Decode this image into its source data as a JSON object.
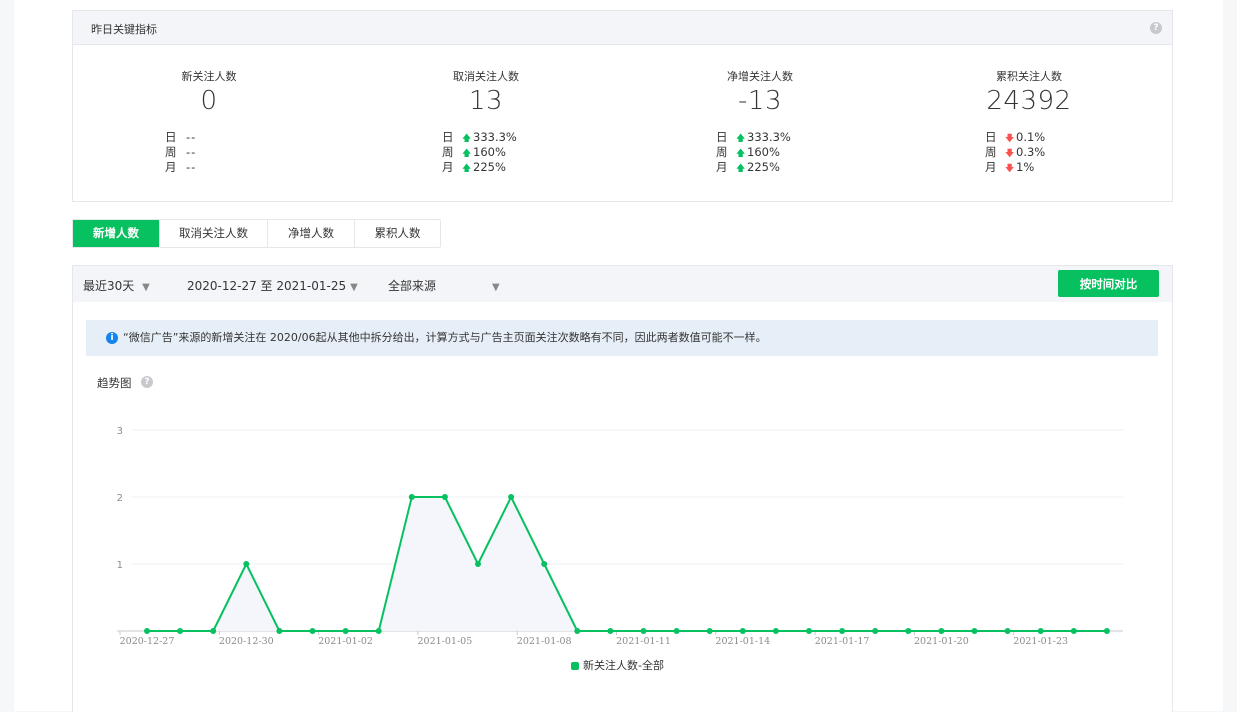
{
  "summary": {
    "title": "昨日关键指标",
    "help_icon": "?",
    "metrics": [
      {
        "label": "新关注人数",
        "value": "0",
        "rows": [
          {
            "period": "日",
            "dir": "none",
            "text": "--"
          },
          {
            "period": "周",
            "dir": "none",
            "text": "--"
          },
          {
            "period": "月",
            "dir": "none",
            "text": "--"
          }
        ]
      },
      {
        "label": "取消关注人数",
        "value": "13",
        "rows": [
          {
            "period": "日",
            "dir": "up",
            "text": "333.3%"
          },
          {
            "period": "周",
            "dir": "up",
            "text": "160%"
          },
          {
            "period": "月",
            "dir": "up",
            "text": "225%"
          }
        ]
      },
      {
        "label": "净增关注人数",
        "value": "-13",
        "rows": [
          {
            "period": "日",
            "dir": "up",
            "text": "333.3%"
          },
          {
            "period": "周",
            "dir": "up",
            "text": "160%"
          },
          {
            "period": "月",
            "dir": "up",
            "text": "225%"
          }
        ]
      },
      {
        "label": "累积关注人数",
        "value": "24392",
        "rows": [
          {
            "period": "日",
            "dir": "down",
            "text": "0.1%"
          },
          {
            "period": "周",
            "dir": "down",
            "text": "0.3%"
          },
          {
            "period": "月",
            "dir": "down",
            "text": "1%"
          }
        ]
      }
    ]
  },
  "tabs": [
    {
      "label": "新增人数",
      "active": true
    },
    {
      "label": "取消关注人数",
      "active": false
    },
    {
      "label": "净增人数",
      "active": false
    },
    {
      "label": "累积人数",
      "active": false
    }
  ],
  "filters": {
    "range": "最近30天",
    "dates": "2020-12-27 至 2021-01-25",
    "source": "全部来源",
    "compare_button": "按时间对比"
  },
  "notice": {
    "icon": "i",
    "text": "“微信广告”来源的新增关注在 2020/06起从其他中拆分给出，计算方式与广告主页面关注次数略有不同，因此两者数值可能不一样。"
  },
  "trend": {
    "title": "趋势图",
    "help_icon": "?"
  },
  "colors": {
    "accent": "#07c160",
    "up": "#07c160",
    "down": "#fa5151",
    "info": "#1485ee"
  },
  "chart_data": {
    "type": "area",
    "x": [
      "2020-12-27",
      "2020-12-28",
      "2020-12-29",
      "2020-12-30",
      "2020-12-31",
      "2021-01-01",
      "2021-01-02",
      "2021-01-03",
      "2021-01-04",
      "2021-01-05",
      "2021-01-06",
      "2021-01-07",
      "2021-01-08",
      "2021-01-09",
      "2021-01-10",
      "2021-01-11",
      "2021-01-12",
      "2021-01-13",
      "2021-01-14",
      "2021-01-15",
      "2021-01-16",
      "2021-01-17",
      "2021-01-18",
      "2021-01-19",
      "2021-01-20",
      "2021-01-21",
      "2021-01-22",
      "2021-01-23",
      "2021-01-24",
      "2021-01-25"
    ],
    "x_tick_labels": [
      "2020-12-27",
      "2020-12-30",
      "2021-01-02",
      "2021-01-05",
      "2021-01-08",
      "2021-01-11",
      "2021-01-14",
      "2021-01-17",
      "2021-01-20",
      "2021-01-23"
    ],
    "series": [
      {
        "name": "新关注人数-全部",
        "color": "#07c160",
        "values": [
          0,
          0,
          0,
          1,
          0,
          0,
          0,
          0,
          2,
          2,
          1,
          2,
          1,
          0,
          0,
          0,
          0,
          0,
          0,
          0,
          0,
          0,
          0,
          0,
          0,
          0,
          0,
          0,
          0,
          0
        ]
      }
    ],
    "yticks": [
      1,
      2,
      3
    ],
    "ylim": [
      0,
      3
    ],
    "grid": true,
    "legend": "bottom-center"
  }
}
